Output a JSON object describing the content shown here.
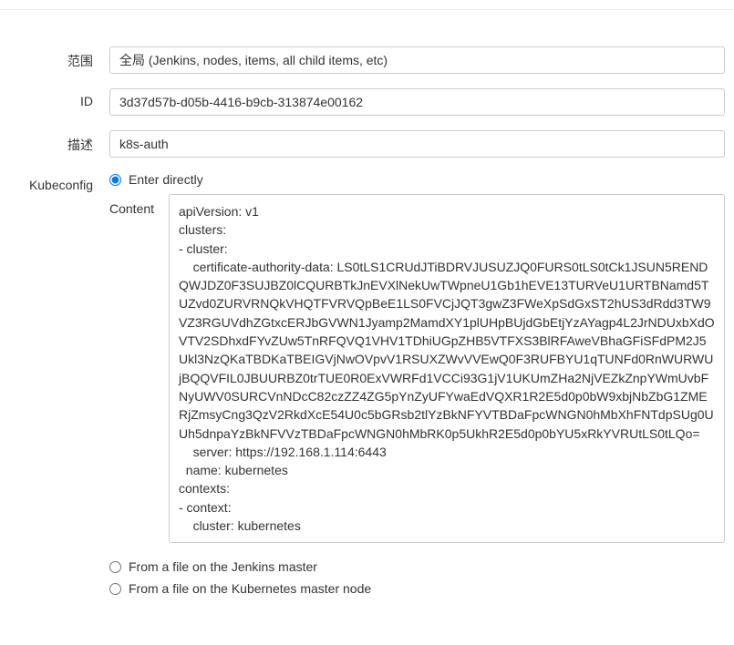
{
  "form": {
    "scope": {
      "label": "范围",
      "value": "全局 (Jenkins, nodes, items, all child items, etc)"
    },
    "id": {
      "label": "ID",
      "value": "3d37d57b-d05b-4416-b9cb-313874e00162"
    },
    "description": {
      "label": "描述",
      "value": "k8s-auth"
    },
    "kubeconfig": {
      "label": "Kubeconfig",
      "contentLabel": "Content",
      "options": {
        "enterDirectly": "Enter directly",
        "fromJenkinsMaster": "From a file on the Jenkins master",
        "fromKubernetesMaster": "From a file on the Kubernetes master node"
      },
      "contentValue": "apiVersion: v1\nclusters:\n- cluster:\n    certificate-authority-data: LS0tLS1CRUdJTiBDRVJUSUZJQ0FURS0tLS0tCk1JSUN5RENDQWJDZ0F3SUJBZ0lCQURBTkJnEVXlNekUwTWpneU1Gb1hEVE13TURVeU1URTBNamd5TUZvd0ZURVRNQkVHQTFVRVQpBeE1LS0FVCjJQT3gwZ3FWeXpSdGxST2hUS3dRdd3TW9VZ3RGUVdhZGtxcERJbGVWN1Jyamp2MamdXY1plUHpBUjdGbEtjYzAYagp4L2JrNDUxbXdOVTV2SDhxdFYvZUw5TnRFQVQ1VHV1TDhiUGpZHB5VTFXS3BlRFAweVBhaGFiSFdPM2J5Ukl3NzQKaTBDKaTBEIGVjNwOVpvV1RSUXZWvVVEwQ0F3RUFBYU1qTUNFd0RnWURWUjBQQVFIL0JBUURBZ0trTUE0R0ExVWRFd1VCCi93G1jV1UKUmZHa2NjVEZkZnpYWmUvbFNyUWV0SURCVnNDcC82czZZ4ZG5pYnZyUFYwaEdVQXR1R2E5d0p0bW9xbjNbZbG1ZMERjZmsyCng3QzV2RkdXcE54U0c5bGRsb2tlYzBkNFYVTBDaFpcWNGN0hMbXhFNTdpSUg0UUh5dnpaYzBkNFVVzTBDaFpcWNGN0hMbRK0p5UkhR2E5d0p0bYU5xRkYVRUtLS0tLQo=\n    server: https://192.168.1.114:6443\n  name: kubernetes\ncontexts:\n- context:\n    cluster: kubernetes"
    }
  }
}
